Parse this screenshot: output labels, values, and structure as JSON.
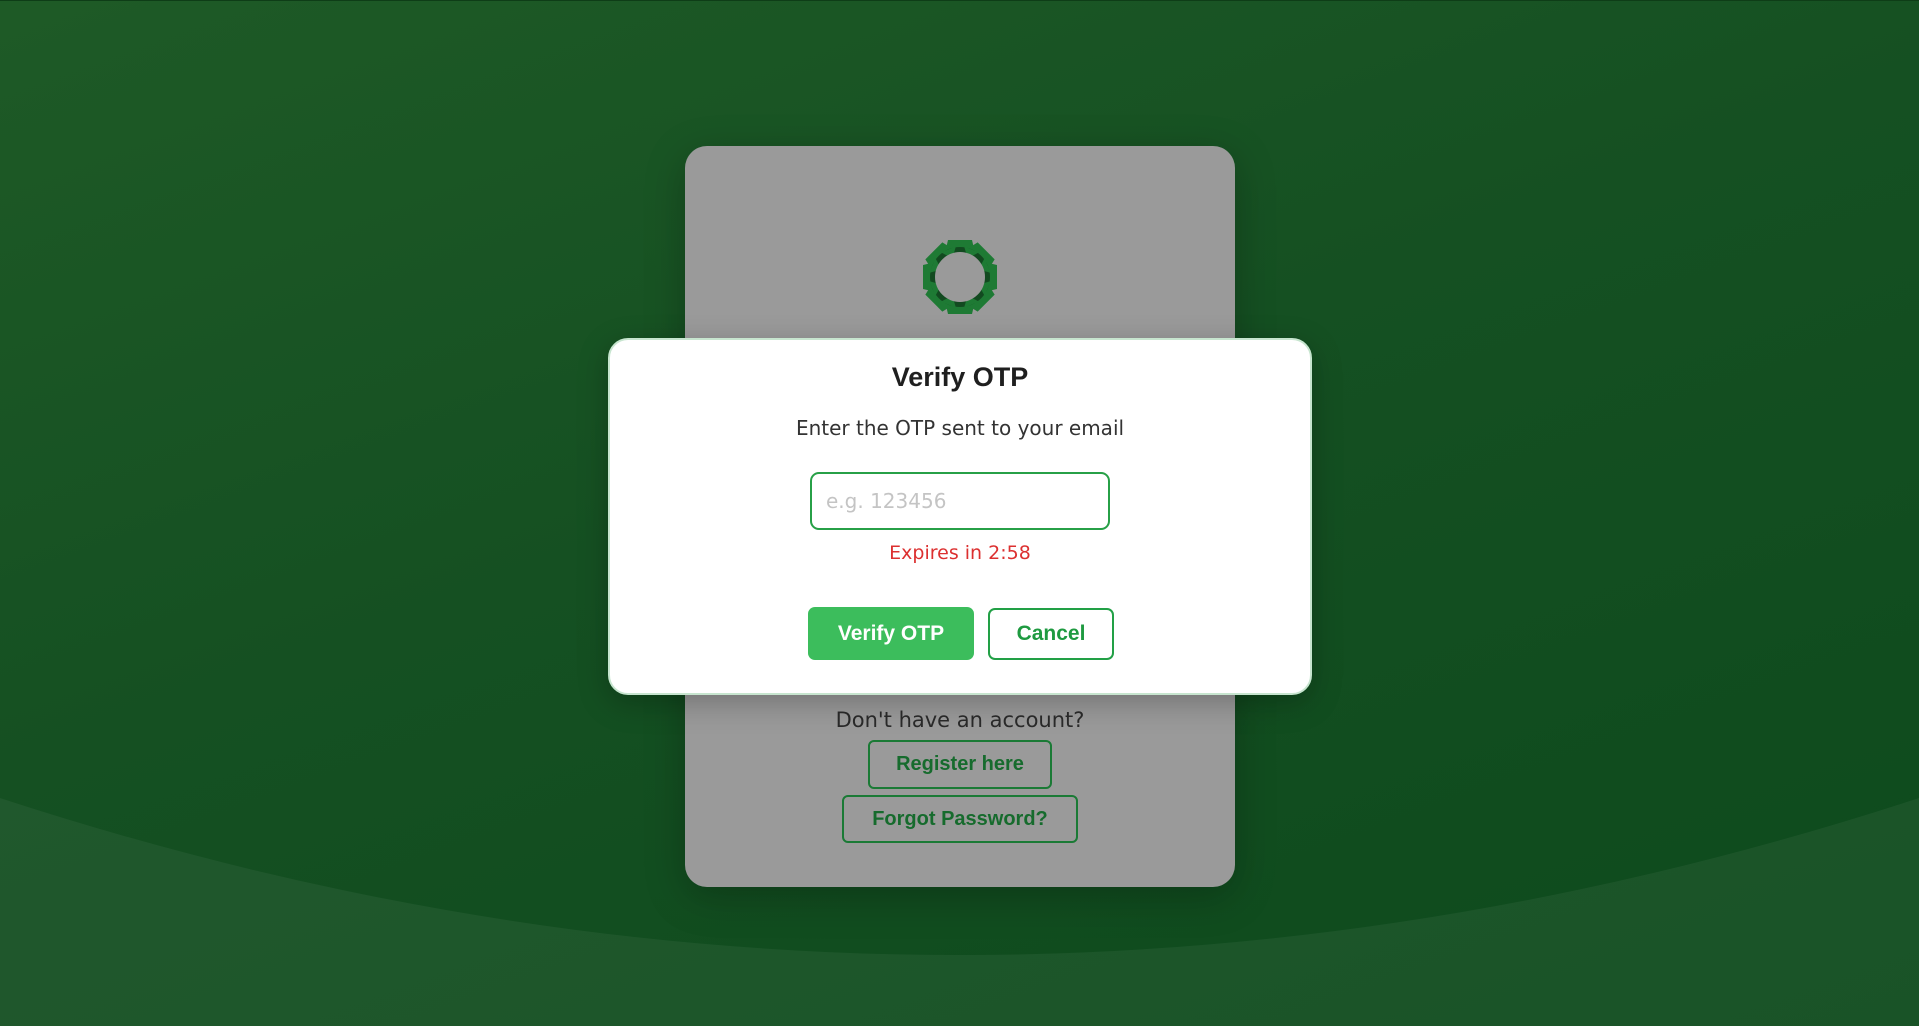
{
  "colors": {
    "background": "#155022",
    "accent": "#3cbd5c",
    "error": "#dc3030"
  },
  "login_card": {
    "logo_icon": "flower-logo-icon",
    "no_account_text": "Don't have an account?",
    "register_label": "Register here",
    "forgot_label": "Forgot Password?"
  },
  "modal": {
    "title": "Verify OTP",
    "subtitle": "Enter the OTP sent to your email",
    "otp_value": "",
    "otp_placeholder": "e.g. 123456",
    "expires_text": "Expires in 2:58",
    "verify_label": "Verify OTP",
    "cancel_label": "Cancel"
  }
}
